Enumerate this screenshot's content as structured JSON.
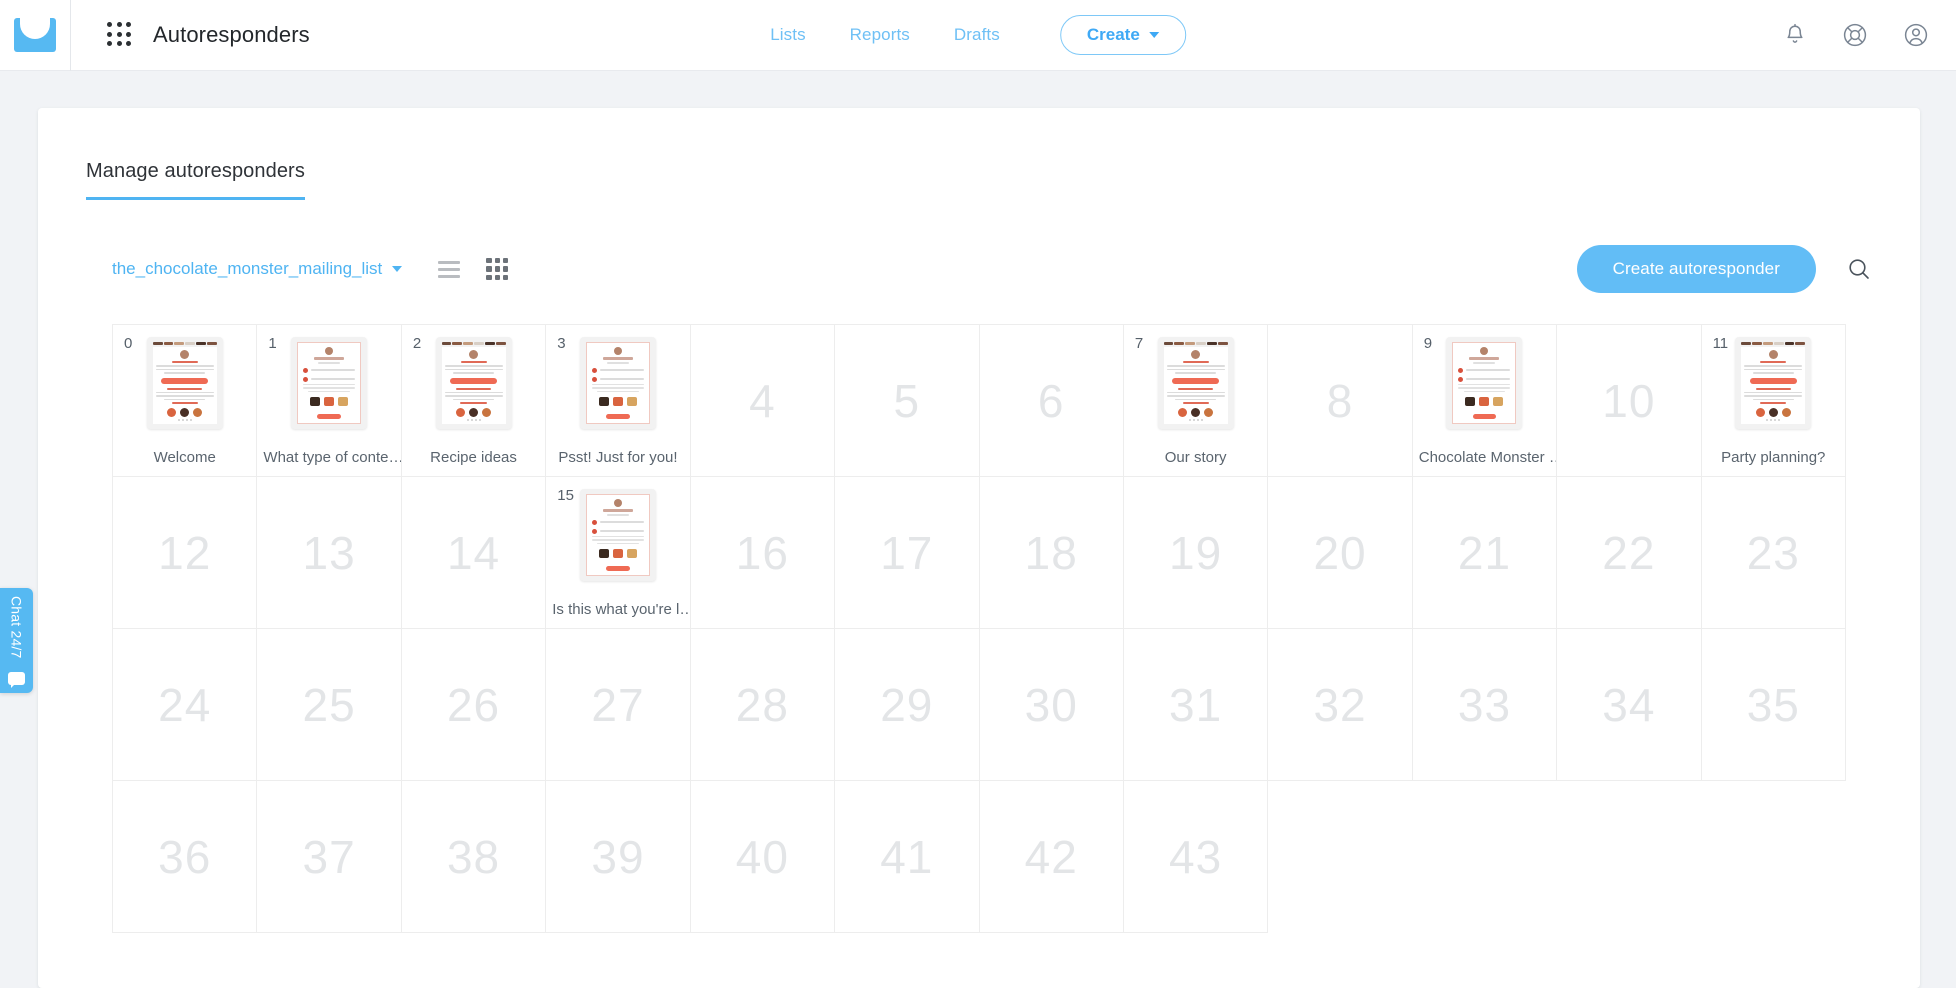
{
  "header": {
    "logo_icon": "envelope-logo-icon",
    "apps_icon": "apps-grid-icon",
    "title": "Autoresponders",
    "nav": [
      {
        "label": "Lists"
      },
      {
        "label": "Reports"
      },
      {
        "label": "Drafts"
      }
    ],
    "create_label": "Create",
    "icons": [
      {
        "name": "notification-bell-icon"
      },
      {
        "name": "lifebuoy-help-icon"
      },
      {
        "name": "user-account-icon"
      }
    ]
  },
  "tabs": [
    {
      "label": "Manage autoresponders",
      "active": true
    }
  ],
  "toolbar": {
    "list_name": "the_chocolate_monster_mailing_list",
    "list_view_icon": "list-view-icon",
    "grid_view_icon": "grid-view-icon",
    "create_autoresponder_label": "Create autoresponder",
    "search_icon": "search-icon"
  },
  "grid": {
    "columns": 12,
    "cells": [
      {
        "index": "0",
        "label": "Welcome",
        "thumb": "A"
      },
      {
        "index": "1",
        "label": "What type of conte…",
        "thumb": "B"
      },
      {
        "index": "2",
        "label": "Recipe ideas",
        "thumb": "A"
      },
      {
        "index": "3",
        "label": "Psst! Just for you!",
        "thumb": "B"
      },
      {
        "index": "4",
        "label": "",
        "thumb": ""
      },
      {
        "index": "5",
        "label": "",
        "thumb": ""
      },
      {
        "index": "6",
        "label": "",
        "thumb": ""
      },
      {
        "index": "7",
        "label": "Our story",
        "thumb": "A"
      },
      {
        "index": "8",
        "label": "",
        "thumb": ""
      },
      {
        "index": "9",
        "label": "Chocolate Monster …",
        "thumb": "B"
      },
      {
        "index": "10",
        "label": "",
        "thumb": ""
      },
      {
        "index": "11",
        "label": "Party planning?",
        "thumb": "A"
      },
      {
        "index": "12",
        "label": "",
        "thumb": ""
      },
      {
        "index": "13",
        "label": "",
        "thumb": ""
      },
      {
        "index": "14",
        "label": "",
        "thumb": ""
      },
      {
        "index": "15",
        "label": "Is this what you're l…",
        "thumb": "B"
      },
      {
        "index": "16",
        "label": "",
        "thumb": ""
      },
      {
        "index": "17",
        "label": "",
        "thumb": ""
      },
      {
        "index": "18",
        "label": "",
        "thumb": ""
      },
      {
        "index": "19",
        "label": "",
        "thumb": ""
      },
      {
        "index": "20",
        "label": "",
        "thumb": ""
      },
      {
        "index": "21",
        "label": "",
        "thumb": ""
      },
      {
        "index": "22",
        "label": "",
        "thumb": ""
      },
      {
        "index": "23",
        "label": "",
        "thumb": ""
      },
      {
        "index": "24",
        "label": "",
        "thumb": ""
      },
      {
        "index": "25",
        "label": "",
        "thumb": ""
      },
      {
        "index": "26",
        "label": "",
        "thumb": ""
      },
      {
        "index": "27",
        "label": "",
        "thumb": ""
      },
      {
        "index": "28",
        "label": "",
        "thumb": ""
      },
      {
        "index": "29",
        "label": "",
        "thumb": ""
      },
      {
        "index": "30",
        "label": "",
        "thumb": ""
      },
      {
        "index": "31",
        "label": "",
        "thumb": ""
      },
      {
        "index": "32",
        "label": "",
        "thumb": ""
      },
      {
        "index": "33",
        "label": "",
        "thumb": ""
      },
      {
        "index": "34",
        "label": "",
        "thumb": ""
      },
      {
        "index": "35",
        "label": "",
        "thumb": ""
      },
      {
        "index": "36",
        "label": "",
        "thumb": ""
      },
      {
        "index": "37",
        "label": "",
        "thumb": ""
      },
      {
        "index": "38",
        "label": "",
        "thumb": ""
      },
      {
        "index": "39",
        "label": "",
        "thumb": ""
      },
      {
        "index": "40",
        "label": "",
        "thumb": ""
      },
      {
        "index": "41",
        "label": "",
        "thumb": ""
      },
      {
        "index": "42",
        "label": "",
        "thumb": ""
      },
      {
        "index": "43",
        "label": "",
        "thumb": ""
      }
    ]
  },
  "chat_widget": {
    "label": "Chat 24/7",
    "icon": "chat-bubble-icon"
  },
  "colors": {
    "brand_blue": "#56b9f2",
    "link_blue": "#6fc0f5",
    "button_blue": "#62bdf6",
    "empty_number_gray": "#e3e5e7"
  }
}
